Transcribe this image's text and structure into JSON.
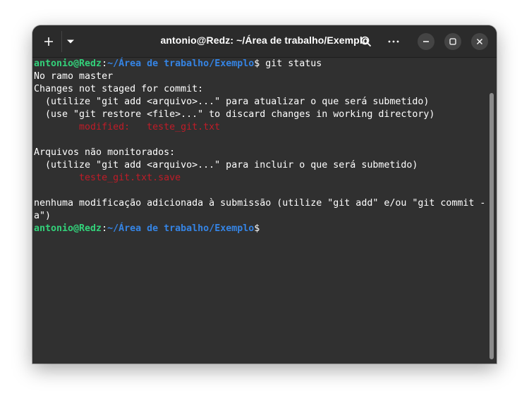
{
  "window": {
    "title": "antonio@Redz: ~/Área de trabalho/Exemplo"
  },
  "titlebar_icons": {
    "new_tab": "plus-icon",
    "tab_menu": "chevron-down-icon",
    "search": "search-icon",
    "menu": "more-icon",
    "minimize": "minimize-icon",
    "maximize": "maximize-icon",
    "close": "close-icon"
  },
  "terminal": {
    "prompt_user": "antonio@Redz",
    "prompt_sep": ":",
    "prompt_path": "~/Área de trabalho/Exemplo",
    "prompt_end": "$",
    "command": " git status",
    "lines": {
      "l1": "No ramo master",
      "l2": "Changes not staged for commit:",
      "l3": "  (utilize \"git add <arquivo>...\" para atualizar o que será submetido)",
      "l4": "  (use \"git restore <file>...\" to discard changes in working directory)",
      "l5_indent": "        ",
      "l5_status": "modified:   teste_git.txt",
      "l6": "",
      "l7": "Arquivos não monitorados:",
      "l8": "  (utilize \"git add <arquivo>...\" para incluir o que será submetido)",
      "l9_indent": "        ",
      "l9_file": "teste_git.txt.save",
      "l10": "",
      "l11": "nenhuma modificação adicionada à submissão (utilize \"git add\" e/ou \"git commit -",
      "l12": "a\")"
    }
  },
  "colors": {
    "prompt_user": "#33d17a",
    "prompt_path": "#3584e4",
    "git_changed": "#c01c28",
    "background": "#303030"
  }
}
